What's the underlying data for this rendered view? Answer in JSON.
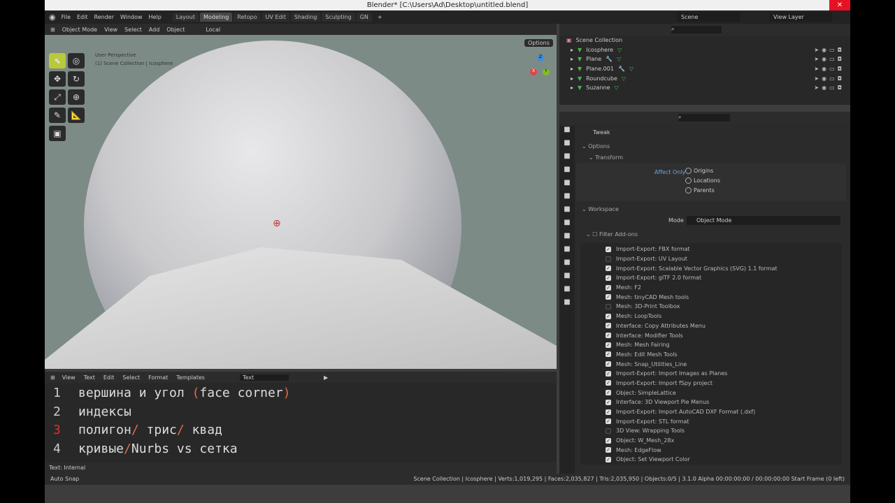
{
  "title": "Blender* [C:\\Users\\Ad\\Desktop\\untitled.blend]",
  "menu": [
    "File",
    "Edit",
    "Render",
    "Window",
    "Help"
  ],
  "workspaces": [
    {
      "label": "Layout",
      "active": false
    },
    {
      "label": "Modeling",
      "active": true
    },
    {
      "label": "Retopo",
      "active": false
    },
    {
      "label": "UV Edit",
      "active": false
    },
    {
      "label": "Shading",
      "active": false
    },
    {
      "label": "Sculpting",
      "active": false
    },
    {
      "label": "GN",
      "active": false
    }
  ],
  "add_workspace": "+",
  "scene": "Scene",
  "view_layer": "View Layer",
  "viewport": {
    "mode": "Object Mode",
    "menus": [
      "View",
      "Select",
      "Add",
      "Object"
    ],
    "orientation": "Local",
    "overlay_title": "User Perspective",
    "overlay_sub": "(1) Scene Collection | Icosphere",
    "options": "Options",
    "gizmo": {
      "x": "X",
      "y": "Y",
      "z": "Z"
    }
  },
  "outliner": {
    "root": "Scene Collection",
    "items": [
      {
        "name": "Icosphere",
        "modifier": false
      },
      {
        "name": "Plane",
        "modifier": true
      },
      {
        "name": "Plane.001",
        "modifier": true
      },
      {
        "name": "Roundcube",
        "modifier": false
      },
      {
        "name": "Suzanne",
        "modifier": false
      }
    ]
  },
  "properties": {
    "tool": "Tweak",
    "options": "Options",
    "transform": "Transform",
    "affect_only": "Affect Only",
    "affect": [
      "Origins",
      "Locations",
      "Parents"
    ],
    "workspace": "Workspace",
    "mode_label": "Mode",
    "mode_value": "Object Mode",
    "filter_addons": "Filter Add-ons",
    "addons": [
      {
        "label": "Import-Export: FBX format",
        "on": true
      },
      {
        "label": "Import-Export: UV Layout",
        "on": false
      },
      {
        "label": "Import-Export: Scalable Vector Graphics (SVG) 1.1 format",
        "on": true
      },
      {
        "label": "Import-Export: glTF 2.0 format",
        "on": true
      },
      {
        "label": "Mesh: F2",
        "on": true
      },
      {
        "label": "Mesh: tinyCAD Mesh tools",
        "on": true
      },
      {
        "label": "Mesh: 3D-Print Toolbox",
        "on": false
      },
      {
        "label": "Mesh: LoopTools",
        "on": true
      },
      {
        "label": "Interface: Copy Attributes Menu",
        "on": true
      },
      {
        "label": "Interface: Modifier Tools",
        "on": true
      },
      {
        "label": "Mesh: Mesh Fairing",
        "on": true
      },
      {
        "label": "Mesh: Edit Mesh Tools",
        "on": true
      },
      {
        "label": "Mesh: Snap_Utilities_Line",
        "on": true
      },
      {
        "label": "Import-Export: Import Images as Planes",
        "on": true
      },
      {
        "label": "Import-Export: Import fSpy project",
        "on": true
      },
      {
        "label": "Object: SimpleLattice",
        "on": true
      },
      {
        "label": "Interface: 3D Viewport Pie Menus",
        "on": true
      },
      {
        "label": "Import-Export: Import AutoCAD DXF Format (.dxf)",
        "on": true
      },
      {
        "label": "Import-Export: STL format",
        "on": true
      },
      {
        "label": "3D View: Wrapping Tools",
        "on": false
      },
      {
        "label": "Object: W_Mesh_28x",
        "on": true
      },
      {
        "label": "Mesh: EdgeFlow",
        "on": true
      },
      {
        "label": "Object: Set Viewport Color",
        "on": true
      }
    ]
  },
  "text_editor": {
    "menus": [
      "View",
      "Text",
      "Edit",
      "Select",
      "Format",
      "Templates"
    ],
    "file": "Text",
    "footer": "Text: Internal",
    "lines": [
      {
        "n": "1",
        "parts": [
          [
            "вершина и угол ",
            ""
          ],
          [
            "(",
            "red"
          ],
          [
            "face corner",
            ""
          ],
          [
            ")",
            "red"
          ]
        ]
      },
      {
        "n": "2",
        "parts": [
          [
            "индексы",
            ""
          ]
        ]
      },
      {
        "n": "3",
        "parts": [
          [
            "полигон",
            ""
          ],
          [
            "/",
            "red"
          ],
          [
            " трис",
            ""
          ],
          [
            "/",
            "red"
          ],
          [
            " квад",
            ""
          ]
        ]
      },
      {
        "n": "4",
        "parts": [
          [
            "кривые",
            ""
          ],
          [
            "/",
            "red"
          ],
          [
            "Nurbs vs сетка",
            ""
          ]
        ]
      }
    ]
  },
  "status": {
    "left": "Auto Snap",
    "right": "Scene Collection | Icosphere | Verts:1,019,295 | Faces:2,035,827 | Tris:2,035,950 | Objects:0/5 | 3.1.0 Alpha  00:00:00:00 / 00:00:00:00  Start Frame (0 left)"
  }
}
